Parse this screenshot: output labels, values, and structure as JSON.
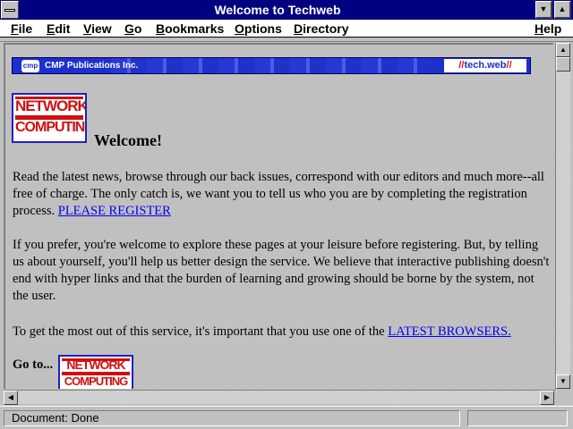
{
  "window": {
    "title": "Welcome to Techweb"
  },
  "menu": {
    "file": "File",
    "edit": "Edit",
    "view": "View",
    "go": "Go",
    "bookmarks": "Bookmarks",
    "options": "Options",
    "directory": "Directory",
    "help": "Help"
  },
  "banner": {
    "publisher": "CMP Publications Inc.",
    "cmp_logo": "cmp",
    "techweb_prefix": "//",
    "techweb": "tech.web",
    "techweb_suffix": "//"
  },
  "logo": {
    "word1": "NETWORK",
    "word2": "COMPUTING"
  },
  "content": {
    "welcome": "Welcome!",
    "para1_text": "Read the latest news, browse through our back issues, correspond with our editors and much more--all free of charge. The only catch is, we want you to tell us who you are by completing the registration process. ",
    "para1_link": "PLEASE REGISTER",
    "para2_text": "If you prefer, you're welcome to explore these pages at your leisure before registering. But, by telling us about yourself, you'll help us better design the service. We believe that interactive publishing doesn't end with hyper links and that the burden of learning and growing should be borne by the system, not the user.",
    "para3_text": "To get the most out of this service, it's important that you use one of the ",
    "para3_link": "LATEST BROWSERS.",
    "goto": "Go to..."
  },
  "status": {
    "text": "Document: Done"
  },
  "colors": {
    "titlebar": "#000080",
    "link": "#0000ee",
    "logo_red": "#d01010",
    "banner_blue": "#1c2fd0"
  },
  "icons": {
    "system_menu": "system-menu-icon",
    "minimize": "minimize-icon",
    "maximize": "maximize-icon",
    "scroll_up": "arrow-up-icon",
    "scroll_down": "arrow-down-icon",
    "scroll_left": "arrow-left-icon",
    "scroll_right": "arrow-right-icon"
  }
}
